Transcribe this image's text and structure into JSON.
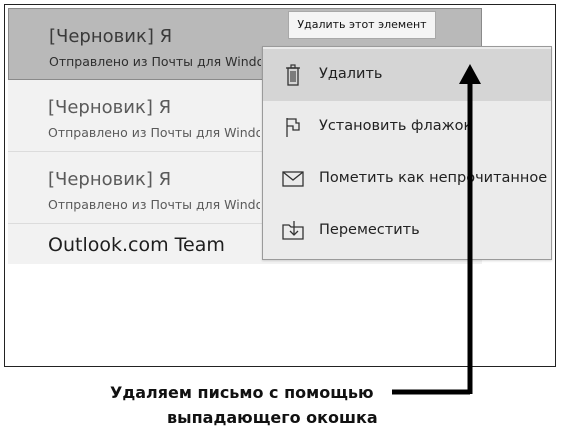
{
  "mail_list": {
    "items": [
      {
        "sender": "[Черновик] Я",
        "preview": "Отправлено из Почты для Windows",
        "selected": true
      },
      {
        "sender": "[Черновик] Я",
        "preview": "Отправлено из Почты для Windows",
        "selected": false
      },
      {
        "sender": "[Черновик] Я",
        "preview": "Отправлено из Почты для Windows",
        "selected": false
      },
      {
        "sender": "Outlook.com Team",
        "preview": "",
        "selected": false
      }
    ]
  },
  "tooltip": {
    "text": "Удалить этот элемент"
  },
  "context_menu": {
    "items": [
      {
        "label": "Удалить",
        "icon": "trash-icon"
      },
      {
        "label": "Установить флажок",
        "icon": "flag-icon"
      },
      {
        "label": "Пометить как непрочитанное",
        "icon": "envelope-icon"
      },
      {
        "label": "Переместить",
        "icon": "move-to-folder-icon"
      }
    ]
  },
  "annotation": {
    "line1": "Удаляем письмо с помощью",
    "line2": "выпадающего окошка"
  }
}
